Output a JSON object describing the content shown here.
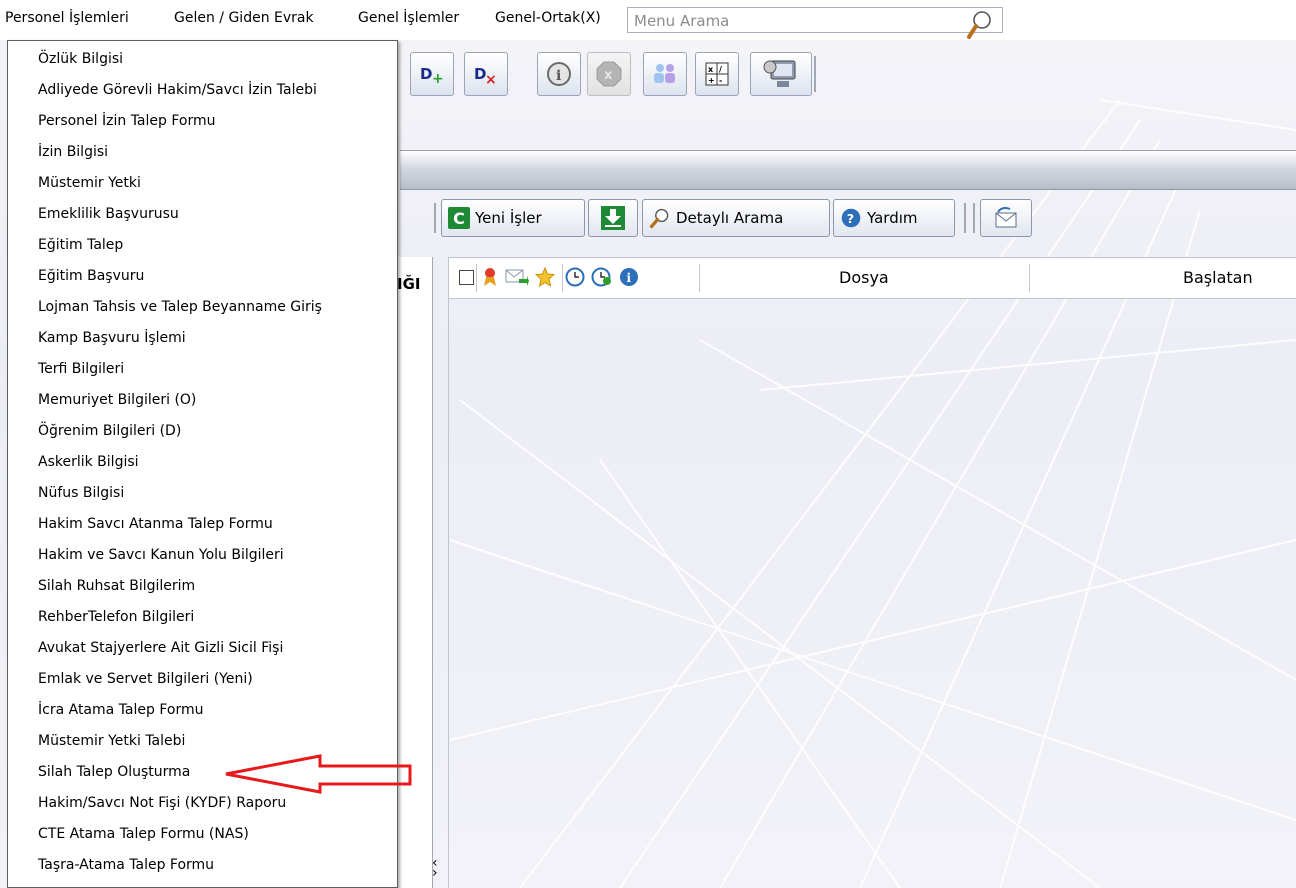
{
  "menubar": {
    "items": [
      {
        "label": "Personel İşlemleri"
      },
      {
        "label": "Gelen / Giden Evrak"
      },
      {
        "label": "Genel İşlemler"
      },
      {
        "label": "Genel-Ortak(X)"
      }
    ],
    "search_placeholder": "Menu Arama"
  },
  "dropdown": {
    "items": [
      {
        "label": "Özlük Bilgisi"
      },
      {
        "label": "Adliyede Görevli Hakim/Savcı İzin Talebi"
      },
      {
        "label": "Personel İzin Talep Formu"
      },
      {
        "label": "İzin Bilgisi"
      },
      {
        "label": "Müstemir Yetki"
      },
      {
        "label": "Emeklilik Başvurusu"
      },
      {
        "label": "Eğitim Talep"
      },
      {
        "label": "Eğitim Başvuru"
      },
      {
        "label": "Lojman Tahsis ve Talep Beyanname Giriş"
      },
      {
        "label": "Kamp Başvuru İşlemi"
      },
      {
        "label": "Terfi Bilgileri"
      },
      {
        "label": "Memuriyet Bilgileri (O)"
      },
      {
        "label": "Öğrenim Bilgileri (D)"
      },
      {
        "label": "Askerlik Bilgisi"
      },
      {
        "label": "Nüfus Bilgisi"
      },
      {
        "label": "Hakim Savcı Atanma Talep Formu"
      },
      {
        "label": "Hakim ve Savcı Kanun Yolu Bilgileri"
      },
      {
        "label": "Silah Ruhsat Bilgilerim"
      },
      {
        "label": "RehberTelefon Bilgileri"
      },
      {
        "label": "Avukat Stajyerlere Ait Gizli Sicil Fişi"
      },
      {
        "label": "Emlak ve Servet Bilgileri (Yeni)"
      },
      {
        "label": "İcra Atama Talep Formu"
      },
      {
        "label": "Müstemir Yetki Talebi"
      },
      {
        "label": "Silah Talep Oluşturma"
      },
      {
        "label": "Hakim/Savcı Not Fişi (KYDF) Raporu"
      },
      {
        "label": "CTE Atama Talep Formu (NAS)"
      },
      {
        "label": "Taşra-Atama Talep Formu"
      }
    ]
  },
  "toolbar2": {
    "yeni_isler": "Yeni İşler",
    "detayli_arama": "Detaylı Arama",
    "yardim": "Yardım"
  },
  "left_panel": {
    "header_fragment": "IĞI"
  },
  "grid": {
    "columns": [
      "Dosya",
      "Başlatan"
    ]
  },
  "colors": {
    "annotation_arrow": "#e8191c",
    "accent": "#2d6fb8"
  }
}
